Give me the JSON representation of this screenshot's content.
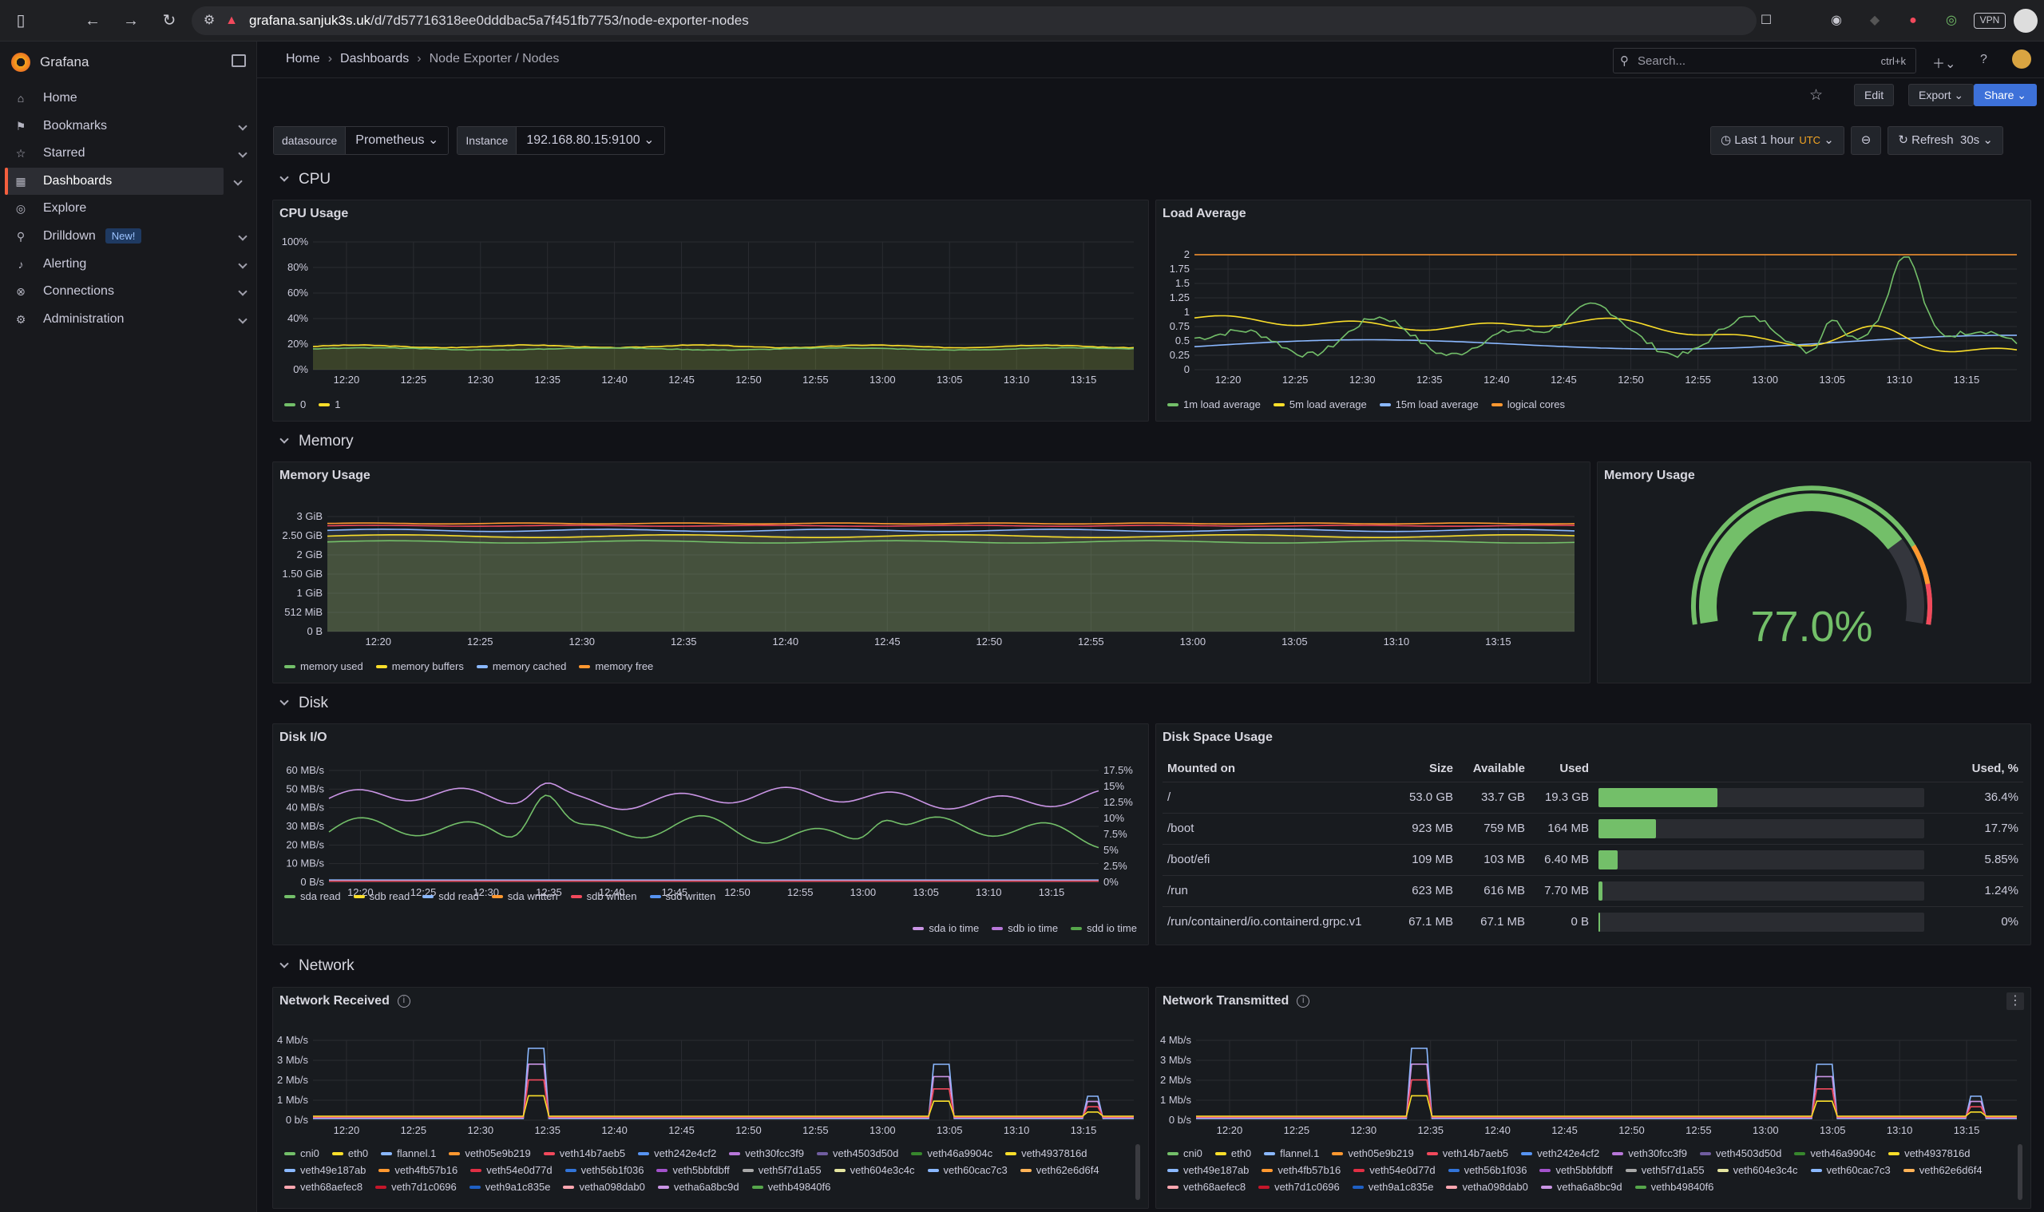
{
  "browser": {
    "url_host": "grafana.sanjuk3s.uk",
    "url_path": "/d/7d57716318ee0dddbac5a7f451fb7753/node-exporter-nodes",
    "vpn_label": "VPN"
  },
  "sidebar": {
    "brand": "Grafana",
    "items": [
      {
        "label": "Home",
        "icon": "home-icon"
      },
      {
        "label": "Bookmarks",
        "icon": "bookmark-icon"
      },
      {
        "label": "Starred",
        "icon": "star-icon"
      },
      {
        "label": "Dashboards",
        "icon": "dashboards-icon"
      },
      {
        "label": "Explore",
        "icon": "compass-icon"
      },
      {
        "label": "Drilldown",
        "icon": "drilldown-icon",
        "badge": "New!"
      },
      {
        "label": "Alerting",
        "icon": "bell-icon"
      },
      {
        "label": "Connections",
        "icon": "connections-icon"
      },
      {
        "label": "Administration",
        "icon": "gear-icon"
      }
    ]
  },
  "topbar": {
    "breadcrumb": [
      "Home",
      "Dashboards",
      "Node Exporter / Nodes"
    ],
    "search_placeholder": "Search...",
    "search_shortcut": "ctrl+k"
  },
  "actions": {
    "edit": "Edit",
    "export": "Export",
    "share": "Share"
  },
  "variables": {
    "datasource_label": "datasource",
    "datasource_value": "Prometheus",
    "instance_label": "Instance",
    "instance_value": "192.168.80.15:9100"
  },
  "time": {
    "range": "Last 1 hour",
    "tz": "UTC",
    "refresh": "Refresh",
    "interval": "30s"
  },
  "rows": {
    "cpu": "CPU",
    "memory": "Memory",
    "disk": "Disk",
    "network": "Network"
  },
  "x_ticks": [
    "12:20",
    "12:25",
    "12:30",
    "12:35",
    "12:40",
    "12:45",
    "12:50",
    "12:55",
    "13:00",
    "13:05",
    "13:10",
    "13:15"
  ],
  "colors": {
    "green": "#73bf69",
    "yellow": "#fade2a",
    "blue": "#8ab8ff",
    "orange": "#ff9830",
    "red": "#f2495c",
    "purple": "#ca95e5"
  },
  "panels": {
    "cpu_usage": {
      "title": "CPU Usage",
      "y_ticks": [
        "100%",
        "80%",
        "60%",
        "40%",
        "20%",
        "0%"
      ],
      "legend": [
        "0",
        "1"
      ]
    },
    "load_average": {
      "title": "Load Average",
      "y_ticks": [
        "2",
        "1.75",
        "1.5",
        "1.25",
        "1",
        "0.75",
        "0.5",
        "0.25",
        "0"
      ],
      "legend": [
        "1m load average",
        "5m load average",
        "15m load average",
        "logical cores"
      ]
    },
    "memory_usage": {
      "title": "Memory Usage",
      "y_ticks": [
        "3 GiB",
        "2.50 GiB",
        "2 GiB",
        "1.50 GiB",
        "1 GiB",
        "512 MiB",
        "0 B"
      ],
      "legend": [
        "memory used",
        "memory buffers",
        "memory cached",
        "memory free"
      ]
    },
    "memory_gauge": {
      "title": "Memory Usage",
      "value": 77.0,
      "display": "77.0%"
    },
    "disk_io": {
      "title": "Disk I/O",
      "y_ticks": [
        "60 MB/s",
        "50 MB/s",
        "40 MB/s",
        "30 MB/s",
        "20 MB/s",
        "10 MB/s",
        "0 B/s"
      ],
      "y2_ticks": [
        "17.5%",
        "15%",
        "12.5%",
        "10%",
        "7.5%",
        "5%",
        "2.5%",
        "0%"
      ],
      "legend": [
        "sda read",
        "sdb read",
        "sdd read",
        "sda written",
        "sdb written",
        "sdd written"
      ],
      "legend2": [
        "sda io time",
        "sdb io time",
        "sdd io time"
      ]
    },
    "disk_space": {
      "title": "Disk Space Usage",
      "headers": [
        "Mounted on",
        "Size",
        "Available",
        "Used",
        "",
        "Used, %"
      ],
      "rows": [
        {
          "mount": "/",
          "size": "53.0 GB",
          "avail": "33.7 GB",
          "used": "19.3 GB",
          "pct": 36.4,
          "pct_label": "36.4%"
        },
        {
          "mount": "/boot",
          "size": "923 MB",
          "avail": "759 MB",
          "used": "164 MB",
          "pct": 17.7,
          "pct_label": "17.7%"
        },
        {
          "mount": "/boot/efi",
          "size": "109 MB",
          "avail": "103 MB",
          "used": "6.40 MB",
          "pct": 5.85,
          "pct_label": "5.85%"
        },
        {
          "mount": "/run",
          "size": "623 MB",
          "avail": "616 MB",
          "used": "7.70 MB",
          "pct": 1.24,
          "pct_label": "1.24%"
        },
        {
          "mount": "/run/containerd/io.containerd.grpc.v1",
          "size": "67.1 MB",
          "avail": "67.1 MB",
          "used": "0 B",
          "pct": 0,
          "pct_label": "0%"
        }
      ]
    },
    "net_rx": {
      "title": "Network Received",
      "y_ticks": [
        "4 Mb/s",
        "3 Mb/s",
        "2 Mb/s",
        "1 Mb/s",
        "0 b/s"
      ]
    },
    "net_tx": {
      "title": "Network Transmitted",
      "y_ticks": [
        "4 Mb/s",
        "3 Mb/s",
        "2 Mb/s",
        "1 Mb/s",
        "0 b/s"
      ]
    },
    "net_legend": [
      "cni0",
      "eth0",
      "flannel.1",
      "veth05e9b219",
      "veth14b7aeb5",
      "veth242e4cf2",
      "veth30fcc3f9",
      "veth4503d50d",
      "veth46a9904c",
      "veth4937816d",
      "veth49e187ab",
      "veth4fb57b16",
      "veth54e0d77d",
      "veth56b1f036",
      "veth5bbfdbff",
      "veth5f7d1a55",
      "veth604e3c4c",
      "veth60cac7c3",
      "veth62e6d6f4",
      "veth68aefec8",
      "veth7d1c0696",
      "veth9a1c835e",
      "vetha098dab0",
      "vetha6a8bc9d",
      "vethb49840f6"
    ]
  }
}
